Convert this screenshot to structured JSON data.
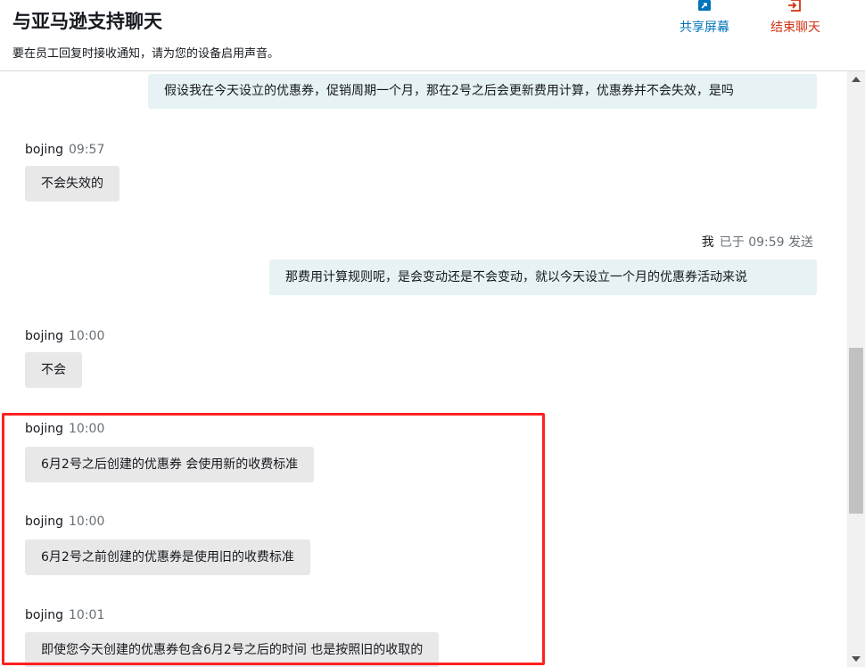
{
  "header": {
    "title": "与亚马逊支持聊天",
    "notice": "要在员工回复时接收通知，请为您的设备启用声音。",
    "share_label": "共享屏幕",
    "end_label": "结束聊天"
  },
  "messages": [
    {
      "text": "假设我在今天设立的优惠券，促销周期一个月，那在2号之后会更新费用计算，优惠券并不会失效，是吗"
    },
    {
      "sender": "bojing",
      "time": "09:57",
      "text": "不会失效的"
    },
    {
      "sender": "我",
      "time": "已于 09:59 发送",
      "text": "那费用计算规则呢，是会变动还是不会变动，就以今天设立一个月的优惠券活动来说"
    },
    {
      "sender": "bojing",
      "time": "10:00",
      "text": "不会"
    },
    {
      "sender": "bojing",
      "time": "10:00",
      "text": "6月2号之后创建的优惠券 会使用新的收费标准"
    },
    {
      "sender": "bojing",
      "time": "10:00",
      "text": "6月2号之前创建的优惠券是使用旧的收费标准"
    },
    {
      "sender": "bojing",
      "time": "10:01",
      "text": "即使您今天创建的优惠券包含6月2号之后的时间 也是按照旧的收取的"
    }
  ],
  "colors": {
    "share": "#0073bb",
    "end": "#d13212",
    "agent_bubble": "#e8e8e8",
    "me_bubble": "#e6f2f4",
    "highlight": "#ff2020"
  }
}
